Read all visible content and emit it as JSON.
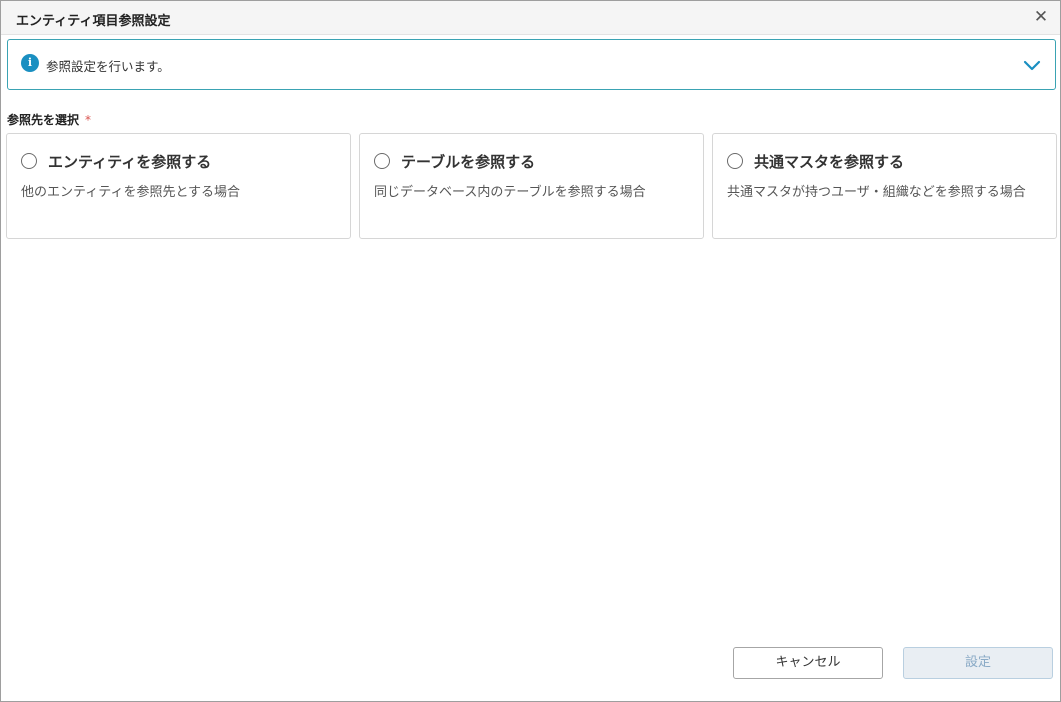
{
  "dialog": {
    "title": "エンティティ項目参照設定",
    "close_symbol": "✕"
  },
  "info": {
    "icon": "info-icon",
    "text": "参照設定を行います。",
    "toggle_icon": "chevron-down-icon",
    "accent_color": "#3aa3b3"
  },
  "selection": {
    "label": "参照先を選択",
    "required_mark": "*",
    "options": [
      {
        "title": "エンティティを参照する",
        "description": "他のエンティティを参照先とする場合",
        "selected": false
      },
      {
        "title": "テーブルを参照する",
        "description": "同じデータベース内のテーブルを参照する場合",
        "selected": false
      },
      {
        "title": "共通マスタを参照する",
        "description": "共通マスタが持つユーザ・組織などを参照する場合",
        "selected": false
      }
    ]
  },
  "footer": {
    "cancel_label": "キャンセル",
    "submit_label": "設定",
    "submit_disabled": true
  }
}
